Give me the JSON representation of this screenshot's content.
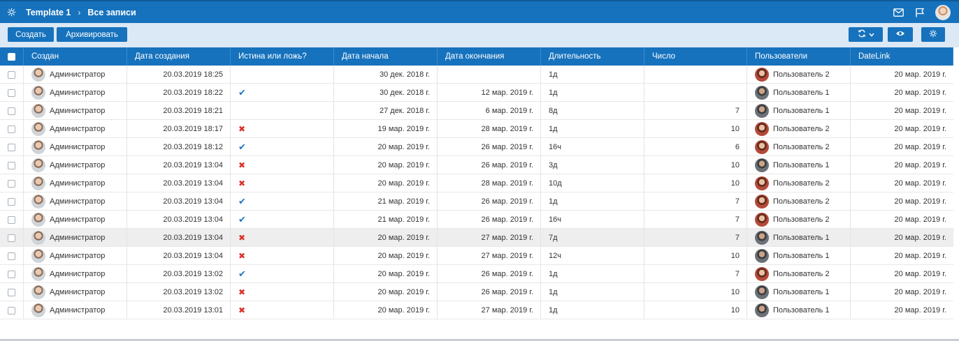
{
  "breadcrumb": {
    "app": "Template 1",
    "separator": "›",
    "view": "Все записи"
  },
  "toolbar": {
    "create": "Создать",
    "archive": "Архивировать"
  },
  "columns": [
    "Создан",
    "Дата создания",
    "Истина или ложь?",
    "Дата начала",
    "Дата окончания",
    "Длительность",
    "Число",
    "Пользователи",
    "DateLink"
  ],
  "rows": [
    {
      "creator": "Администратор",
      "created": "20.03.2019 18:25",
      "bool": "",
      "start": "30 дек. 2018 г.",
      "end": "",
      "duration": "1д",
      "number": "",
      "user": "Пользователь 2",
      "datelink": "20 мар. 2019 г."
    },
    {
      "creator": "Администратор",
      "created": "20.03.2019 18:22",
      "bool": "true",
      "start": "30 дек. 2018 г.",
      "end": "12 мар. 2019 г.",
      "duration": "1д",
      "number": "",
      "user": "Пользователь 1",
      "datelink": "20 мар. 2019 г."
    },
    {
      "creator": "Администратор",
      "created": "20.03.2019 18:21",
      "bool": "",
      "start": "27 дек. 2018 г.",
      "end": "6 мар. 2019 г.",
      "duration": "8д",
      "number": "7",
      "user": "Пользователь 1",
      "datelink": "20 мар. 2019 г."
    },
    {
      "creator": "Администратор",
      "created": "20.03.2019 18:17",
      "bool": "false",
      "start": "19 мар. 2019 г.",
      "end": "28 мар. 2019 г.",
      "duration": "1д",
      "number": "10",
      "user": "Пользователь 2",
      "datelink": "20 мар. 2019 г."
    },
    {
      "creator": "Администратор",
      "created": "20.03.2019 18:12",
      "bool": "true",
      "start": "20 мар. 2019 г.",
      "end": "26 мар. 2019 г.",
      "duration": "16ч",
      "number": "6",
      "user": "Пользователь 2",
      "datelink": "20 мар. 2019 г."
    },
    {
      "creator": "Администратор",
      "created": "20.03.2019 13:04",
      "bool": "false",
      "start": "20 мар. 2019 г.",
      "end": "26 мар. 2019 г.",
      "duration": "3д",
      "number": "10",
      "user": "Пользователь 1",
      "datelink": "20 мар. 2019 г."
    },
    {
      "creator": "Администратор",
      "created": "20.03.2019 13:04",
      "bool": "false",
      "start": "20 мар. 2019 г.",
      "end": "28 мар. 2019 г.",
      "duration": "10д",
      "number": "10",
      "user": "Пользователь 2",
      "datelink": "20 мар. 2019 г."
    },
    {
      "creator": "Администратор",
      "created": "20.03.2019 13:04",
      "bool": "true",
      "start": "21 мар. 2019 г.",
      "end": "26 мар. 2019 г.",
      "duration": "1д",
      "number": "7",
      "user": "Пользователь 2",
      "datelink": "20 мар. 2019 г."
    },
    {
      "creator": "Администратор",
      "created": "20.03.2019 13:04",
      "bool": "true",
      "start": "21 мар. 2019 г.",
      "end": "26 мар. 2019 г.",
      "duration": "16ч",
      "number": "7",
      "user": "Пользователь 2",
      "datelink": "20 мар. 2019 г."
    },
    {
      "creator": "Администратор",
      "created": "20.03.2019 13:04",
      "bool": "false",
      "start": "20 мар. 2019 г.",
      "end": "27 мар. 2019 г.",
      "duration": "7д",
      "number": "7",
      "user": "Пользователь 1",
      "datelink": "20 мар. 2019 г.",
      "highlighted": true
    },
    {
      "creator": "Администратор",
      "created": "20.03.2019 13:04",
      "bool": "false",
      "start": "20 мар. 2019 г.",
      "end": "27 мар. 2019 г.",
      "duration": "12ч",
      "number": "10",
      "user": "Пользователь 1",
      "datelink": "20 мар. 2019 г."
    },
    {
      "creator": "Администратор",
      "created": "20.03.2019 13:02",
      "bool": "true",
      "start": "20 мар. 2019 г.",
      "end": "26 мар. 2019 г.",
      "duration": "1д",
      "number": "7",
      "user": "Пользователь 2",
      "datelink": "20 мар. 2019 г."
    },
    {
      "creator": "Администратор",
      "created": "20.03.2019 13:02",
      "bool": "false",
      "start": "20 мар. 2019 г.",
      "end": "26 мар. 2019 г.",
      "duration": "1д",
      "number": "10",
      "user": "Пользователь 1",
      "datelink": "20 мар. 2019 г."
    },
    {
      "creator": "Администратор",
      "created": "20.03.2019 13:01",
      "bool": "false",
      "start": "20 мар. 2019 г.",
      "end": "27 мар. 2019 г.",
      "duration": "1д",
      "number": "10",
      "user": "Пользователь 1",
      "datelink": "20 мар. 2019 г."
    }
  ],
  "icons": {
    "app_settings": "gear-icon",
    "mail": "mail-icon",
    "flag": "flag-icon",
    "refresh": "refresh-icon",
    "view": "eye-icon",
    "settings": "gear-icon"
  },
  "colors": {
    "accent": "#1672bd",
    "toolbar_bg": "#dbe8f5",
    "true_mark": "#1f75c4",
    "false_mark": "#d9342b",
    "highlight_row": "#eeeeee"
  }
}
